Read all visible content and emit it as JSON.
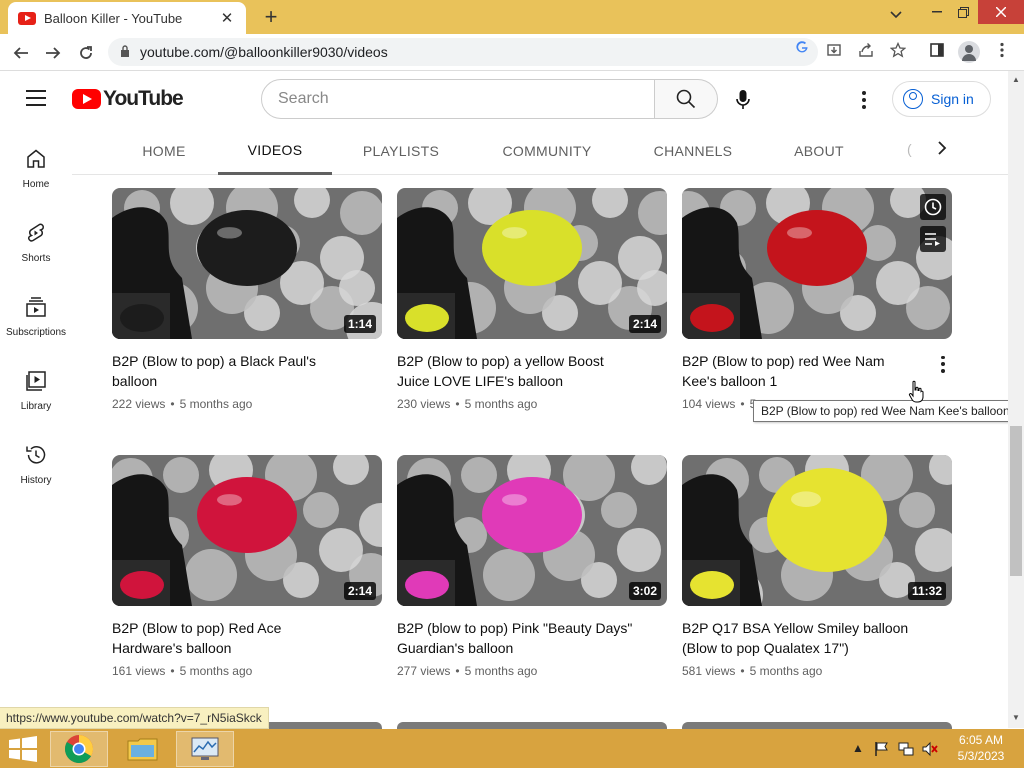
{
  "browser": {
    "tab_title": "Balloon Killer - YouTube",
    "tab_close": "✕",
    "new_tab": "+",
    "url": "youtube.com/@balloonkiller9030/videos",
    "status_url": "https://www.youtube.com/watch?v=7_rN5iaSkck"
  },
  "header": {
    "logo_text": "YouTube",
    "search_placeholder": "Search",
    "signin_label": "Sign in"
  },
  "sidebar": {
    "items": [
      {
        "label": "Home"
      },
      {
        "label": "Shorts"
      },
      {
        "label": "Subscriptions"
      },
      {
        "label": "Library"
      },
      {
        "label": "History"
      }
    ]
  },
  "channel_tabs": [
    {
      "label": "HOME"
    },
    {
      "label": "VIDEOS"
    },
    {
      "label": "PLAYLISTS"
    },
    {
      "label": "COMMUNITY"
    },
    {
      "label": "CHANNELS"
    },
    {
      "label": "ABOUT"
    }
  ],
  "videos": [
    {
      "title": "B2P (Blow to pop) a Black Paul's balloon",
      "views": "222 views",
      "age": "5 months ago",
      "duration": "1:14",
      "balloon_color": "#1c1c1c"
    },
    {
      "title": "B2P (Blow to pop) a yellow Boost Juice LOVE LIFE's balloon",
      "views": "230 views",
      "age": "5 months ago",
      "duration": "2:14",
      "balloon_color": "#d9e02a"
    },
    {
      "title": "B2P (Blow to pop) red Wee Nam Kee's balloon 1",
      "views": "104 views",
      "age": "5",
      "duration": "",
      "balloon_color": "#c4141c"
    },
    {
      "title": "B2P (Blow to pop) Red Ace Hardware's balloon",
      "views": "161 views",
      "age": "5 months ago",
      "duration": "2:14",
      "balloon_color": "#d0143c"
    },
    {
      "title": "B2P (blow to pop) Pink \"Beauty Days\" Guardian's balloon",
      "views": "277 views",
      "age": "5 months ago",
      "duration": "3:02",
      "balloon_color": "#e03ab8"
    },
    {
      "title": "B2P Q17 BSA Yellow Smiley balloon (Blow to pop Qualatex 17\")",
      "views": "581 views",
      "age": "5 months ago",
      "duration": "11:32",
      "balloon_color": "#e6e330"
    }
  ],
  "meta_separator": "•",
  "tooltip": "B2P (Blow to pop) red Wee Nam Kee's balloon 1",
  "taskbar": {
    "time": "6:05 AM",
    "date": "5/3/2023"
  }
}
